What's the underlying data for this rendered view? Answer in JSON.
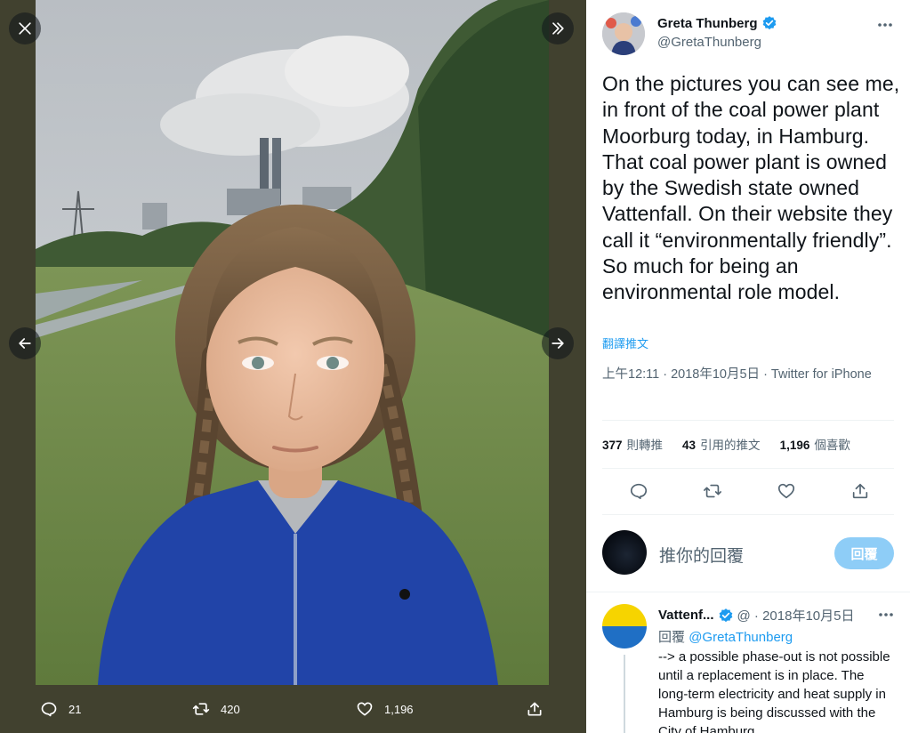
{
  "viewer": {
    "actions": {
      "reply_count": "21",
      "retweet_count": "420",
      "like_count": "1,196"
    }
  },
  "tweet": {
    "author_name": "Greta Thunberg",
    "author_handle": "@GretaThunberg",
    "text": "On the pictures you can see me, in front of the coal power plant Moorburg today, in Hamburg. That coal power plant is owned by the Swedish state owned Vattenfall. On their website they call it “environmentally friendly”. So much for being an environmental role model.",
    "translate_label": "翻譯推文",
    "timestamp": "上午12:11 · 2018年10月5日 · Twitter for iPhone",
    "stats": {
      "retweets_value": "377",
      "retweets_label": "則轉推",
      "quotes_value": "43",
      "quotes_label": "引用的推文",
      "likes_value": "1,196",
      "likes_label": "個喜歡"
    }
  },
  "compose": {
    "placeholder": "推你的回覆",
    "reply_button": "回覆"
  },
  "reply_tweet": {
    "author_name": "Vattenf...",
    "handle_date": "@ · 2018年10月5日",
    "reply_prefix": "回覆",
    "reply_to": "@GretaThunberg",
    "text": "--> a possible phase-out is not possible until a replacement is in place. The long-term electricity and heat supply in Hamburg is being discussed with the City of Hamburg"
  },
  "colors": {
    "accent": "#1d9bf0",
    "reply_button_disabled": "#8ecdf7",
    "viewer_bg": "#41412f",
    "secondary_text": "#536471"
  },
  "icons": [
    "close-icon",
    "expand-icon",
    "arrow-left-icon",
    "arrow-right-icon",
    "reply-icon",
    "retweet-icon",
    "like-icon",
    "share-icon",
    "verified-icon",
    "more-icon"
  ]
}
